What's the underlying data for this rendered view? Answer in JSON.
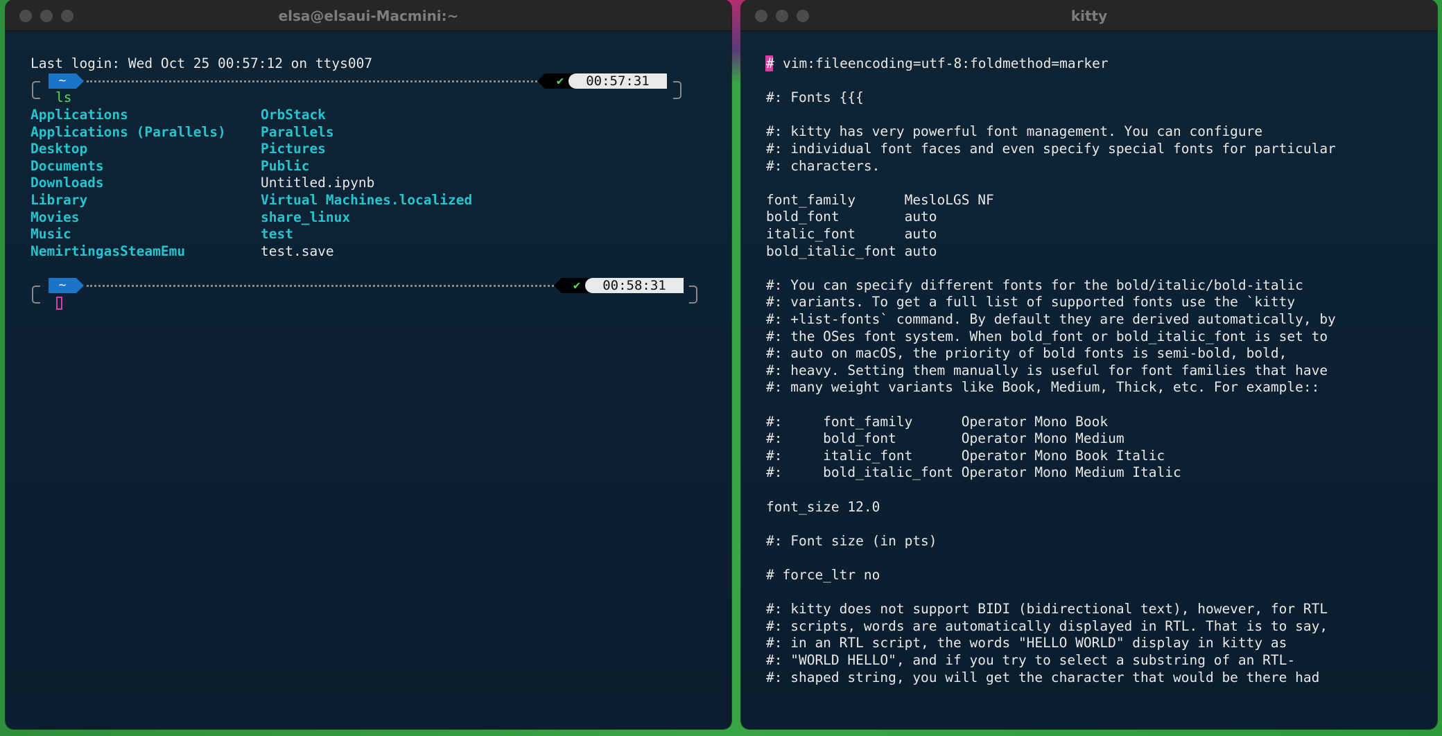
{
  "left_window": {
    "title": "elsa@elsaui-Macmini:~",
    "last_login": "Last login: Wed Oct 25 00:57:12 on ttys007",
    "prompt1": {
      "dir": "~",
      "status": "✔",
      "time": "00:57:31",
      "command": "ls"
    },
    "ls_col1": [
      {
        "name": "Applications",
        "kind": "dir"
      },
      {
        "name": "Applications (Parallels)",
        "kind": "dir"
      },
      {
        "name": "Desktop",
        "kind": "dir"
      },
      {
        "name": "Documents",
        "kind": "dir"
      },
      {
        "name": "Downloads",
        "kind": "dir"
      },
      {
        "name": "Library",
        "kind": "dir"
      },
      {
        "name": "Movies",
        "kind": "dir"
      },
      {
        "name": "Music",
        "kind": "dir"
      },
      {
        "name": "NemirtingasSteamEmu",
        "kind": "dir"
      }
    ],
    "ls_col2": [
      {
        "name": "OrbStack",
        "kind": "dir"
      },
      {
        "name": "Parallels",
        "kind": "dir"
      },
      {
        "name": "Pictures",
        "kind": "dir"
      },
      {
        "name": "Public",
        "kind": "dir"
      },
      {
        "name": "Untitled.ipynb",
        "kind": "file"
      },
      {
        "name": "Virtual Machines.localized",
        "kind": "dir"
      },
      {
        "name": "share_linux",
        "kind": "dir"
      },
      {
        "name": "test",
        "kind": "dir"
      },
      {
        "name": "test.save",
        "kind": "file"
      }
    ],
    "prompt2": {
      "dir": "~",
      "status": "✔",
      "time": "00:58:31"
    }
  },
  "right_window": {
    "title": "kitty",
    "first_line": "vim:fileencoding=utf-8:foldmethod=marker",
    "first_line_hash": "#",
    "lines": [
      "",
      "#: Fonts {{{",
      "",
      "#: kitty has very powerful font management. You can configure",
      "#: individual font faces and even specify special fonts for particular",
      "#: characters.",
      "",
      "font_family      MesloLGS NF",
      "bold_font        auto",
      "italic_font      auto",
      "bold_italic_font auto",
      "",
      "#: You can specify different fonts for the bold/italic/bold-italic",
      "#: variants. To get a full list of supported fonts use the `kitty",
      "#: +list-fonts` command. By default they are derived automatically, by",
      "#: the OSes font system. When bold_font or bold_italic_font is set to",
      "#: auto on macOS, the priority of bold fonts is semi-bold, bold,",
      "#: heavy. Setting them manually is useful for font families that have",
      "#: many weight variants like Book, Medium, Thick, etc. For example::",
      "",
      "#:     font_family      Operator Mono Book",
      "#:     bold_font        Operator Mono Medium",
      "#:     italic_font      Operator Mono Book Italic",
      "#:     bold_italic_font Operator Mono Medium Italic",
      "",
      "font_size 12.0",
      "",
      "#: Font size (in pts)",
      "",
      "# force_ltr no",
      "",
      "#: kitty does not support BIDI (bidirectional text), however, for RTL",
      "#: scripts, words are automatically displayed in RTL. That is to say,",
      "#: in an RTL script, the words \"HELLO WORLD\" display in kitty as",
      "#: \"WORLD HELLO\", and if you try to select a substring of an RTL-",
      "#: shaped string, you will get the character that would be there had"
    ]
  }
}
